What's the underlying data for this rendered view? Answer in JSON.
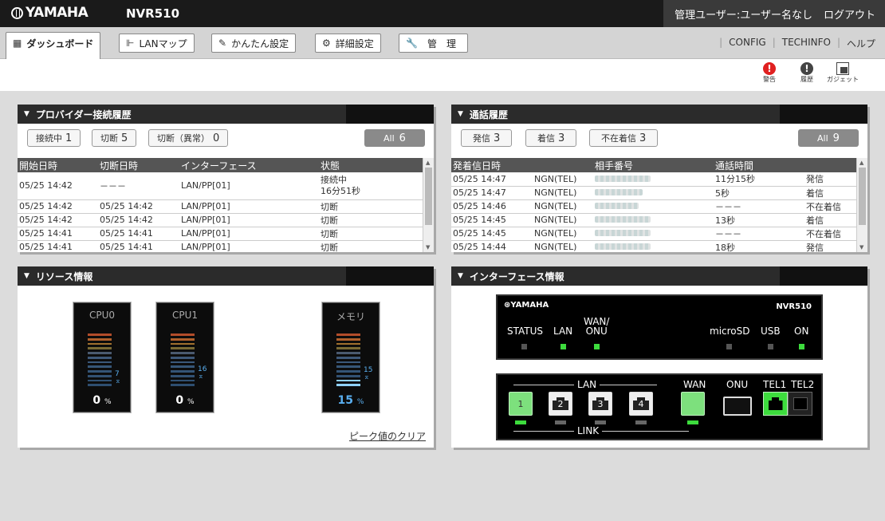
{
  "header": {
    "brand": "YAMAHA",
    "model": "NVR510",
    "user_text": "管理ユーザー:ユーザー名なし",
    "logout_label": "ログアウト"
  },
  "tabs": [
    {
      "label": "ダッシュボード",
      "icon": "grid-icon",
      "active": true
    },
    {
      "label": "LANマップ",
      "icon": "network-map-icon"
    },
    {
      "label": "かんたん設定",
      "icon": "wand-icon"
    },
    {
      "label": "詳細設定",
      "icon": "gear-icon"
    },
    {
      "label": "管　理",
      "icon": "wrench-icon"
    }
  ],
  "top_links": [
    "CONFIG",
    "TECHINFO",
    "ヘルプ"
  ],
  "toolbar_icons": [
    {
      "label": "警告",
      "icon": "warning-icon",
      "color": "#e02020"
    },
    {
      "label": "履歴",
      "icon": "history-icon",
      "color": "#444444"
    },
    {
      "label": "ガジェット",
      "icon": "gadget-icon",
      "color": "#444444"
    }
  ],
  "provider_panel": {
    "title": "プロバイダー接続履歴",
    "filters": [
      {
        "label": "接続中",
        "count": "1"
      },
      {
        "label": "切断",
        "count": "5"
      },
      {
        "label": "切断（異常）",
        "count": "0"
      }
    ],
    "all": {
      "label": "All",
      "count": "6"
    },
    "columns": [
      "開始日時",
      "切断日時",
      "インターフェース",
      "状態"
    ],
    "rows": [
      [
        "05/25 14:42",
        "－－－",
        "LAN/PP[01]",
        "接続中\n16分51秒"
      ],
      [
        "05/25 14:42",
        "05/25 14:42",
        "LAN/PP[01]",
        "切断"
      ],
      [
        "05/25 14:42",
        "05/25 14:42",
        "LAN/PP[01]",
        "切断"
      ],
      [
        "05/25 14:41",
        "05/25 14:41",
        "LAN/PP[01]",
        "切断"
      ],
      [
        "05/25 14:41",
        "05/25 14:41",
        "LAN/PP[01]",
        "切断"
      ]
    ]
  },
  "call_panel": {
    "title": "通話履歴",
    "filters": [
      {
        "label": "発信",
        "count": "3"
      },
      {
        "label": "着信",
        "count": "3"
      },
      {
        "label": "不在着信",
        "count": "3"
      }
    ],
    "all": {
      "label": "All",
      "count": "9"
    },
    "columns": [
      "発着信日時",
      "",
      "相手番号",
      "通話時間",
      ""
    ],
    "rows": [
      [
        "05/25 14:47",
        "NGN(TEL)",
        "",
        "11分15秒",
        "発信"
      ],
      [
        "05/25 14:47",
        "NGN(TEL)",
        "",
        "5秒",
        "着信"
      ],
      [
        "05/25 14:46",
        "NGN(TEL)",
        "",
        "－－－",
        "不在着信"
      ],
      [
        "05/25 14:45",
        "NGN(TEL)",
        "",
        "13秒",
        "着信"
      ],
      [
        "05/25 14:45",
        "NGN(TEL)",
        "",
        "－－－",
        "不在着信"
      ],
      [
        "05/25 14:44",
        "NGN(TEL)",
        "",
        "18秒",
        "発信"
      ]
    ]
  },
  "resource_panel": {
    "title": "リソース情報",
    "meters": [
      {
        "label": "CPU0",
        "percent": "0",
        "peak": "7",
        "peak_fraction": 0.07
      },
      {
        "label": "CPU1",
        "percent": "0",
        "peak": "16",
        "peak_fraction": 0.16
      },
      {
        "label": "メモリ",
        "percent": "15",
        "peak": "15",
        "peak_fraction": 0.15
      }
    ],
    "percent_unit": "%",
    "clear_label": "ピーク値のクリア"
  },
  "interface_panel": {
    "title": "インターフェース情報",
    "front": {
      "brand": "YAMAHA",
      "model": "NVR510",
      "leds": [
        {
          "label": "STATUS",
          "on": false
        },
        {
          "label": "LAN",
          "on": true
        },
        {
          "label": "WAN/\nONU",
          "on": true
        },
        {
          "label": "microSD",
          "on": false
        },
        {
          "label": "USB",
          "on": false
        },
        {
          "label": "ON",
          "on": true
        }
      ]
    },
    "rear": {
      "lan_group_label": "LAN",
      "link_label": "LINK",
      "lan_ports": [
        {
          "label": "1",
          "on": true
        },
        {
          "label": "2",
          "on": false
        },
        {
          "label": "3",
          "on": false
        },
        {
          "label": "4",
          "on": false
        }
      ],
      "wan_label": "WAN",
      "onu_label": "ONU",
      "tel1_label": "TEL1",
      "tel2_label": "TEL2",
      "accent_color": "#3ddc3d"
    }
  }
}
